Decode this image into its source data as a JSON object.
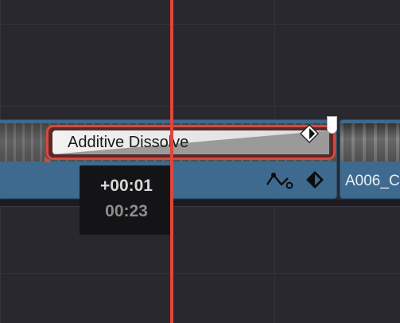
{
  "timeline": {
    "transition": {
      "name": "Additive Dissolve",
      "border_color": "#d9483d",
      "keyframe_icon": "keyframe-diamond-icon"
    },
    "clip_right": {
      "name": "A006_C"
    },
    "clip_color": "#3f6a8f",
    "clip_icons": {
      "curve": "curve-editor-icon",
      "keyframe": "keyframe-icon"
    },
    "tooltip": {
      "offset": "+00:01",
      "duration": "00:23"
    },
    "playhead_color": "#e0463c",
    "background_color": "#28282e"
  }
}
